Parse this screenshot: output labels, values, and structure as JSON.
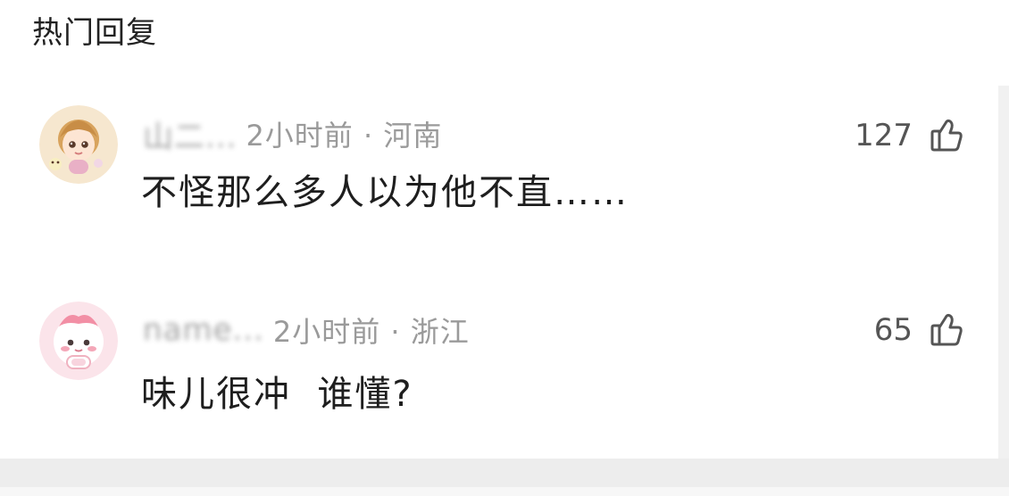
{
  "section": {
    "title": "热门回复"
  },
  "comments": [
    {
      "username": "山二...",
      "time_location": "2小时前 · 河南",
      "text": "不怪那么多人以为他不直……",
      "likes": "127",
      "avatar_icon": "anime-girl-avatar",
      "colors": {
        "avatar_bg": "#f6e7cf",
        "hair": "#d8a35d",
        "skin": "#fde5d3",
        "accent": "#e9b0c6"
      }
    },
    {
      "username": "name...",
      "time_location": "2小时前 · 浙江",
      "text": "味儿很冲  谁懂?",
      "likes": "65",
      "avatar_icon": "pink-character-avatar",
      "colors": {
        "avatar_bg": "#fbe4ea",
        "face": "#ffffff",
        "cheek": "#f4a7b8",
        "ribbon": "#f28fa5"
      }
    }
  ],
  "icons": {
    "like": "thumbs-up-icon"
  }
}
